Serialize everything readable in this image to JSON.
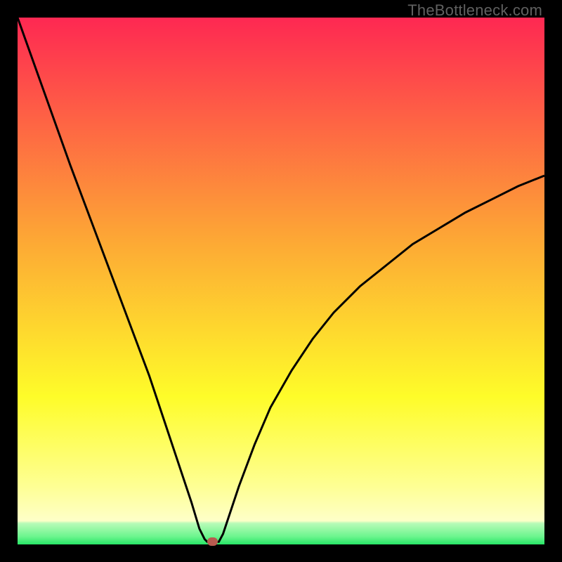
{
  "watermark": "TheBottleneck.com",
  "chart_data": {
    "type": "line",
    "title": "",
    "xlabel": "",
    "ylabel": "",
    "xlim": [
      0,
      100
    ],
    "ylim": [
      0,
      100
    ],
    "grid": false,
    "legend": false,
    "background_gradient": {
      "top": "#fe2852",
      "mid1": "#fda735",
      "mid2": "#fefc29",
      "mid3": "#feff94",
      "bottom_band": "#6cf58e",
      "bottom_line": "#27e566"
    },
    "series": [
      {
        "name": "bottleneck-curve",
        "color": "#000000",
        "x": [
          0,
          5,
          10,
          13,
          16,
          19,
          22,
          25,
          27,
          29,
          31,
          33,
          34.5,
          35.5,
          36,
          36.5,
          37,
          38.2,
          39,
          40,
          42,
          45,
          48,
          52,
          56,
          60,
          65,
          70,
          75,
          80,
          85,
          90,
          95,
          100
        ],
        "y": [
          100,
          86,
          72,
          64,
          56,
          48,
          40,
          32,
          26,
          20,
          14,
          8,
          3,
          1,
          0.5,
          0.5,
          0.5,
          0.5,
          2,
          5,
          11,
          19,
          26,
          33,
          39,
          44,
          49,
          53,
          57,
          60,
          63,
          65.5,
          68,
          70
        ]
      }
    ],
    "marker": {
      "x": 37,
      "y": 0.5,
      "color": "#b85b50"
    }
  }
}
